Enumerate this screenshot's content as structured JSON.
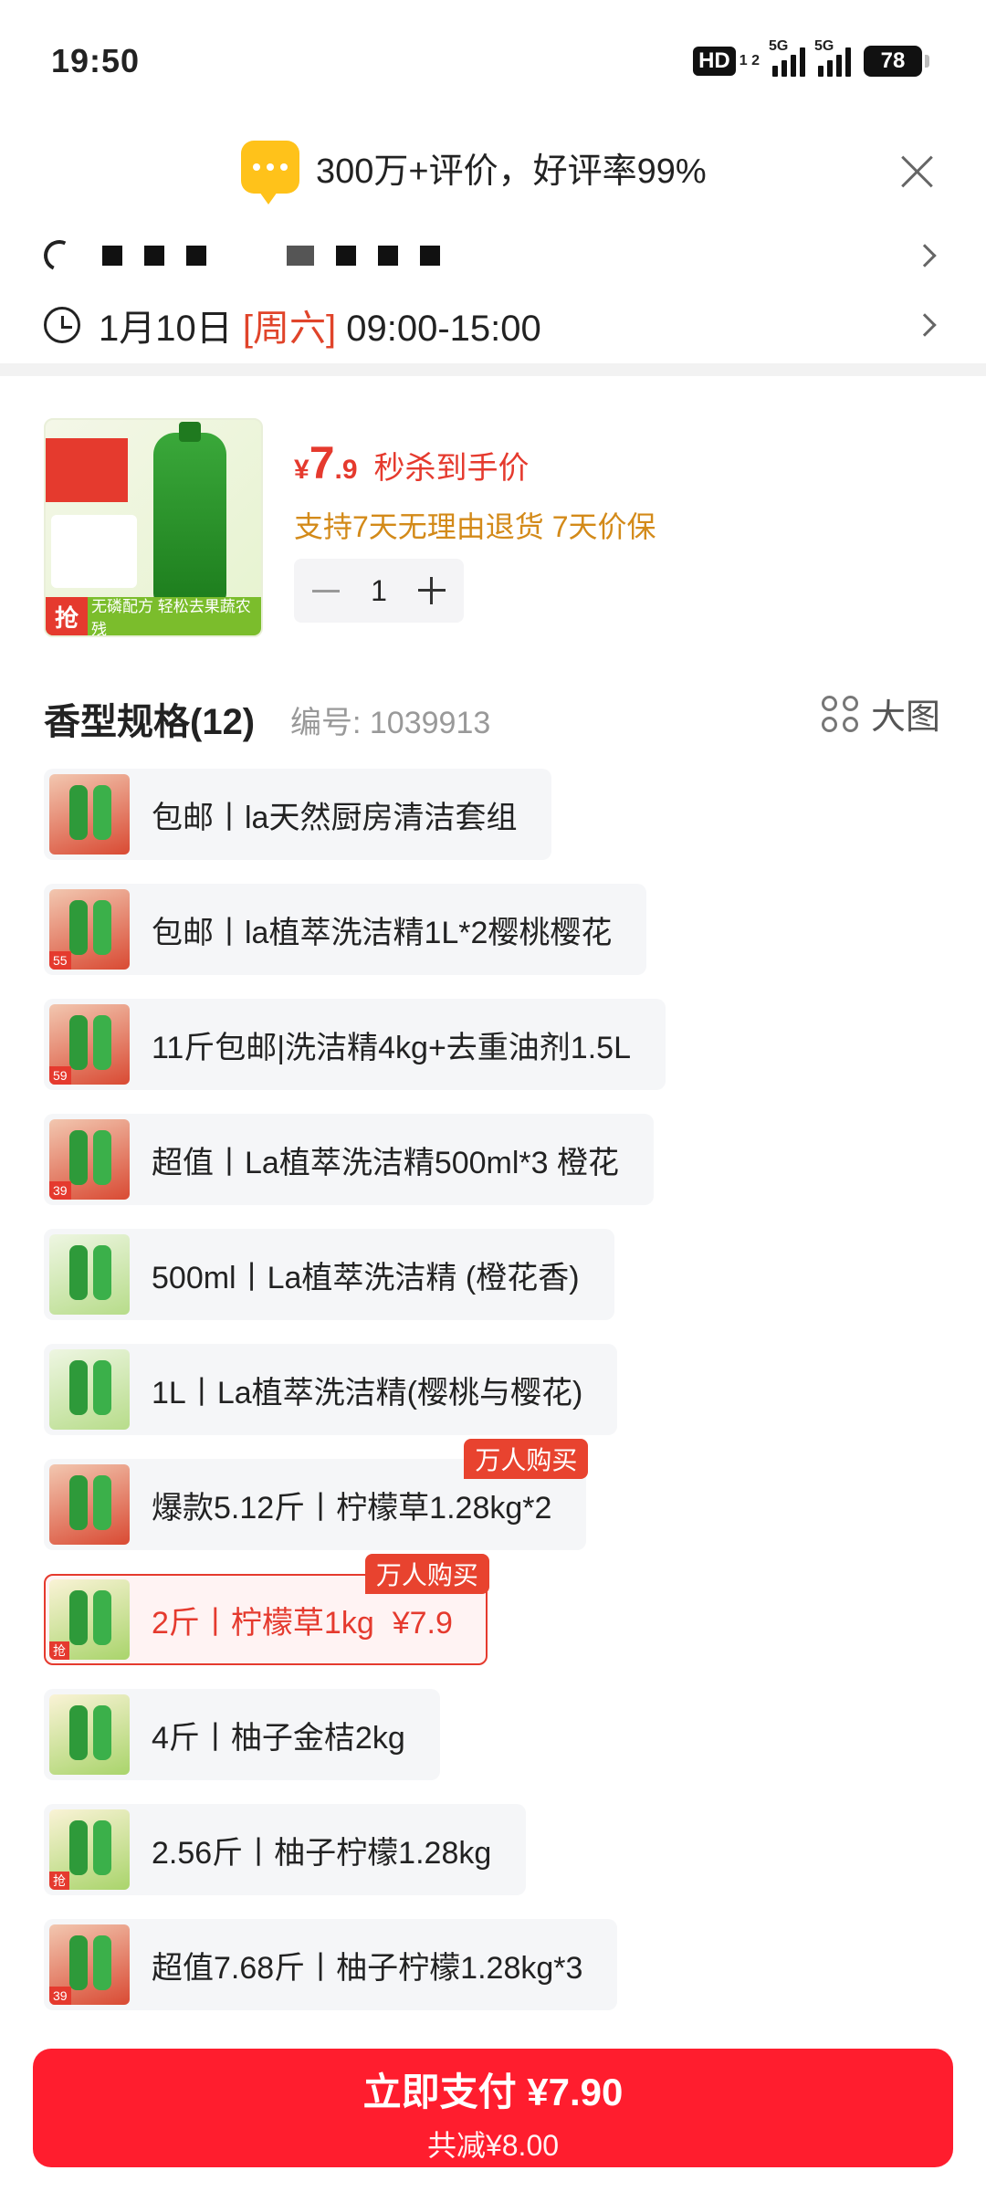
{
  "status_bar": {
    "time": "19:50",
    "hd": "HD",
    "hd_sub": "1 2",
    "net1": "5G",
    "net2": "5G",
    "battery": "78"
  },
  "banner": {
    "text": "300万+评价，好评率99%"
  },
  "delivery": {
    "date": "1月10日",
    "weekday": "[周六]",
    "window": "09:00-15:00"
  },
  "product": {
    "price_symbol": "¥",
    "price_int": "7",
    "price_dec": ".9",
    "price_label": "秒杀到手价",
    "guarantee": "支持7天无理由退货 7天价保",
    "quantity": "1",
    "img_strip": "无磷配方 轻松去果蔬农残",
    "img_grab": "抢"
  },
  "spec": {
    "title": "香型规格(12)",
    "code": "编号: 1039913",
    "big_view": "大图",
    "items": [
      {
        "label": "包邮丨la天然厨房清洁套组",
        "tag": ""
      },
      {
        "label": "包邮丨la植萃洗洁精1L*2樱桃樱花",
        "tag": "55"
      },
      {
        "label": "11斤包邮|洗洁精4kg+去重油剂1.5L",
        "tag": "59"
      },
      {
        "label": "超值丨La植萃洗洁精500ml*3 橙花",
        "tag": "39"
      },
      {
        "label": "500ml丨La植萃洗洁精 (橙花香)",
        "tag": ""
      },
      {
        "label": "1L丨La植萃洗洁精(樱桃与樱花)",
        "tag": ""
      },
      {
        "label": "爆款5.12斤丨柠檬草1.28kg*2",
        "tag": "",
        "badge": "万人购买"
      },
      {
        "label": "2斤丨柠檬草1kg",
        "price": "¥7.9",
        "tag": "抢",
        "badge": "万人购买",
        "selected": true
      },
      {
        "label": "4斤丨柚子金桔2kg",
        "tag": ""
      },
      {
        "label": "2.56斤丨柚子柠檬1.28kg",
        "tag": "抢"
      },
      {
        "label": "超值7.68斤丨柚子柠檬1.28kg*3",
        "tag": "39"
      }
    ]
  },
  "pay": {
    "main": "立即支付 ¥7.90",
    "sub": "共减¥8.00"
  }
}
